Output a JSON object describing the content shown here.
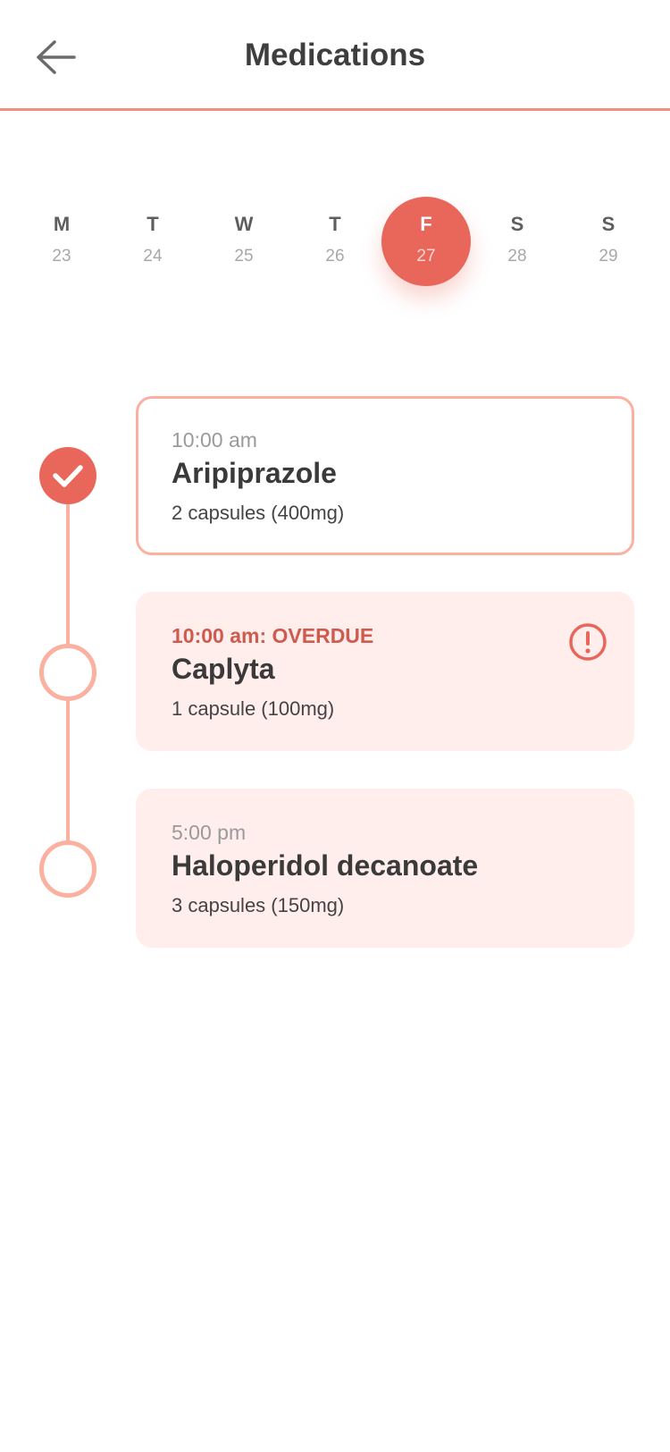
{
  "header": {
    "title": "Medications",
    "back_icon": "arrow-left-icon"
  },
  "week": {
    "selected_index": 4,
    "days": [
      {
        "dow": "M",
        "num": "23"
      },
      {
        "dow": "T",
        "num": "24"
      },
      {
        "dow": "W",
        "num": "25"
      },
      {
        "dow": "T",
        "num": "26"
      },
      {
        "dow": "F",
        "num": "27"
      },
      {
        "dow": "S",
        "num": "28"
      },
      {
        "dow": "S",
        "num": "29"
      }
    ]
  },
  "medications": [
    {
      "time": "10:00 am",
      "name": "Aripiprazole",
      "dose": "2 capsules (400mg)",
      "status": "taken"
    },
    {
      "time": "10:00 am: OVERDUE",
      "name": "Caplyta",
      "dose": "1 capsule (100mg)",
      "status": "overdue"
    },
    {
      "time": "5:00 pm",
      "name": "Haloperidol decanoate",
      "dose": "3 capsules (150mg)",
      "status": "upcoming"
    }
  ],
  "colors": {
    "accent": "#e8675a",
    "accent_light": "#fbb0a0",
    "card_soft_bg": "#ffeeec",
    "overdue_text": "#cf5a4e",
    "header_rule": "#f29080"
  }
}
